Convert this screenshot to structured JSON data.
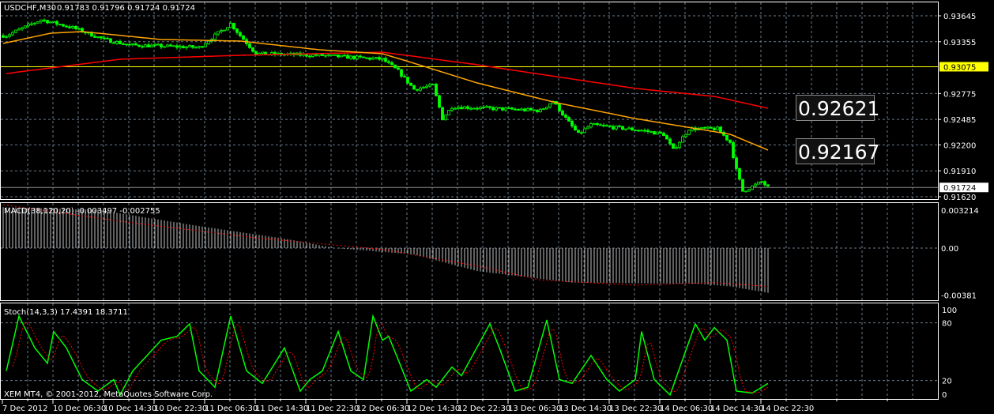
{
  "header": {
    "symbol": "USDCHF,M30",
    "ohlc": "0.91783 0.91796 0.91724 0.91724"
  },
  "macd_label": "MACD(38,120,20) -0.003497 -0.002755",
  "stoch_label": "Stoch(14,3,3) 17.4391 18.3711",
  "copyright": "XEM MT4, © 2001-2012, MetaQuotes Software Corp.",
  "price_boxes": [
    "0.92621",
    "0.92167"
  ],
  "colors": {
    "candle": "#00ff00",
    "ma_fast": "#ffa500",
    "ma_slow": "#ff0000",
    "highlight": "#ffff00"
  },
  "chart_data": {
    "type": "candlestick",
    "bars": 243,
    "price_axis": {
      "ticks": [
        "0.93645",
        "0.93355",
        "0.92775",
        "0.92485",
        "0.92200",
        "0.91910",
        "0.91620"
      ],
      "highlight": "0.93075",
      "current": "0.91724",
      "range": [
        0.9162,
        0.93645
      ]
    },
    "time_labels": [
      "7 Dec 2012",
      "10 Dec 06:30",
      "10 Dec 14:30",
      "10 Dec 22:30",
      "11 Dec 06:30",
      "11 Dec 14:30",
      "11 Dec 22:30",
      "12 Dec 06:30",
      "12 Dec 14:30",
      "12 Dec 22:30",
      "13 Dec 06:30",
      "13 Dec 14:30",
      "13 Dec 22:30",
      "14 Dec 06:30",
      "14 Dec 14:30",
      "14 Dec 22:30"
    ],
    "close_path": [
      [
        1,
        0.93424
      ],
      [
        12,
        0.93601
      ],
      [
        22,
        0.93512
      ],
      [
        32,
        0.9338
      ],
      [
        40,
        0.93318
      ],
      [
        62,
        0.93291
      ],
      [
        72,
        0.93557
      ],
      [
        75,
        0.93424
      ],
      [
        80,
        0.93221
      ],
      [
        100,
        0.93203
      ],
      [
        120,
        0.93159
      ],
      [
        125,
        0.93026
      ],
      [
        130,
        0.92823
      ],
      [
        136,
        0.92867
      ],
      [
        139,
        0.92495
      ],
      [
        142,
        0.92628
      ],
      [
        170,
        0.92584
      ],
      [
        174,
        0.9269
      ],
      [
        179,
        0.92451
      ],
      [
        182,
        0.92319
      ],
      [
        186,
        0.92425
      ],
      [
        202,
        0.92363
      ],
      [
        209,
        0.92319
      ],
      [
        212,
        0.92142
      ],
      [
        217,
        0.9238
      ],
      [
        226,
        0.9238
      ],
      [
        230,
        0.9223
      ],
      [
        232,
        0.91921
      ],
      [
        234,
        0.91682
      ],
      [
        240,
        0.91788
      ],
      [
        242,
        0.91724
      ]
    ],
    "ma_fast": [
      [
        0,
        0.93336
      ],
      [
        15,
        0.9345
      ],
      [
        25,
        0.93468
      ],
      [
        50,
        0.9338
      ],
      [
        75,
        0.93362
      ],
      [
        100,
        0.93265
      ],
      [
        120,
        0.93221
      ],
      [
        130,
        0.93114
      ],
      [
        150,
        0.92893
      ],
      [
        175,
        0.92672
      ],
      [
        200,
        0.92495
      ],
      [
        215,
        0.92407
      ],
      [
        230,
        0.92319
      ],
      [
        242,
        0.92142
      ]
    ],
    "ma_slow": [
      [
        1,
        0.92999
      ],
      [
        37,
        0.93159
      ],
      [
        75,
        0.93203
      ],
      [
        120,
        0.93238
      ],
      [
        150,
        0.93097
      ],
      [
        200,
        0.92832
      ],
      [
        225,
        0.92743
      ],
      [
        242,
        0.9261
      ]
    ],
    "macd": {
      "axis": [
        "0.003214",
        "0.00",
        "-0.00381"
      ],
      "range": [
        -0.00381,
        0.003214
      ],
      "hist": [
        [
          0,
          0.0032
        ],
        [
          30,
          0.003
        ],
        [
          60,
          0.0018
        ],
        [
          90,
          0.0007
        ],
        [
          105,
          0
        ],
        [
          130,
          -0.0005
        ],
        [
          150,
          -0.0018
        ],
        [
          180,
          -0.0027
        ],
        [
          220,
          -0.0028
        ],
        [
          230,
          -0.003
        ],
        [
          242,
          -0.0035
        ]
      ],
      "signal": [
        [
          0,
          0.0034
        ],
        [
          40,
          0.002
        ],
        [
          80,
          0.0008
        ],
        [
          120,
          -0.0001
        ],
        [
          150,
          -0.0014
        ],
        [
          170,
          -0.0025
        ],
        [
          200,
          -0.0029
        ],
        [
          225,
          -0.0027
        ],
        [
          242,
          -0.003
        ]
      ]
    },
    "stoch": {
      "axis": [
        "100",
        "80",
        "20",
        "0"
      ],
      "main": [
        [
          1,
          30
        ],
        [
          5,
          87
        ],
        [
          10,
          54
        ],
        [
          14,
          38
        ],
        [
          16,
          71
        ],
        [
          20,
          54
        ],
        [
          25,
          21
        ],
        [
          30,
          9
        ],
        [
          35,
          21
        ],
        [
          37,
          5
        ],
        [
          41,
          30
        ],
        [
          50,
          62
        ],
        [
          55,
          66
        ],
        [
          59,
          79
        ],
        [
          62,
          30
        ],
        [
          67,
          13
        ],
        [
          72,
          87
        ],
        [
          77,
          30
        ],
        [
          82,
          17
        ],
        [
          89,
          54
        ],
        [
          94,
          9
        ],
        [
          97,
          21
        ],
        [
          101,
          30
        ],
        [
          106,
          71
        ],
        [
          110,
          30
        ],
        [
          114,
          21
        ],
        [
          117,
          87
        ],
        [
          120,
          62
        ],
        [
          122,
          66
        ],
        [
          129,
          9
        ],
        [
          134,
          21
        ],
        [
          137,
          13
        ],
        [
          142,
          34
        ],
        [
          145,
          25
        ],
        [
          154,
          79
        ],
        [
          157,
          54
        ],
        [
          162,
          9
        ],
        [
          166,
          13
        ],
        [
          172,
          83
        ],
        [
          176,
          21
        ],
        [
          180,
          17
        ],
        [
          186,
          46
        ],
        [
          191,
          21
        ],
        [
          195,
          9
        ],
        [
          200,
          21
        ],
        [
          202,
          71
        ],
        [
          206,
          21
        ],
        [
          211,
          5
        ],
        [
          219,
          79
        ],
        [
          222,
          62
        ],
        [
          225,
          75
        ],
        [
          229,
          62
        ],
        [
          232,
          9
        ],
        [
          237,
          7
        ],
        [
          242,
          17
        ]
      ]
    }
  }
}
